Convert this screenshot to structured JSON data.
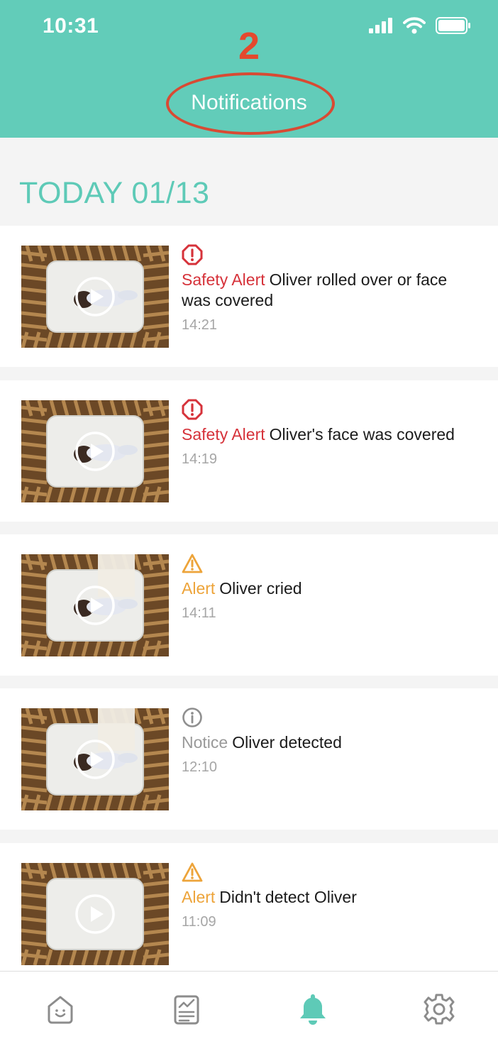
{
  "status": {
    "time": "10:31"
  },
  "annotation": {
    "number": "2"
  },
  "header": {
    "title": "Notifications"
  },
  "section": {
    "date": "TODAY 01/13"
  },
  "colors": {
    "teal": "#62ccb9",
    "safety": "#d6323a",
    "alert": "#eda43a",
    "notice": "#999999"
  },
  "notifications": [
    {
      "severity": "safety",
      "icon": "safety-octagon-icon",
      "label": "Safety Alert",
      "message": "Oliver rolled over or face was covered",
      "time": "14:21"
    },
    {
      "severity": "safety",
      "icon": "safety-octagon-icon",
      "label": "Safety Alert",
      "message": "Oliver's face was covered",
      "time": "14:19"
    },
    {
      "severity": "alert",
      "icon": "warning-triangle-icon",
      "label": "Alert",
      "message": "Oliver cried",
      "time": "14:11"
    },
    {
      "severity": "notice",
      "icon": "info-circle-icon",
      "label": "Notice",
      "message": "Oliver detected",
      "time": "12:10"
    },
    {
      "severity": "alert",
      "icon": "warning-triangle-icon",
      "label": "Alert",
      "message": "Didn't detect Oliver",
      "time": "11:09"
    }
  ],
  "tabs": [
    {
      "name": "home",
      "icon": "home-smile-icon",
      "active": false
    },
    {
      "name": "report",
      "icon": "report-chart-icon",
      "active": false
    },
    {
      "name": "notifications",
      "icon": "bell-icon",
      "active": true
    },
    {
      "name": "settings",
      "icon": "gear-icon",
      "active": false
    }
  ]
}
